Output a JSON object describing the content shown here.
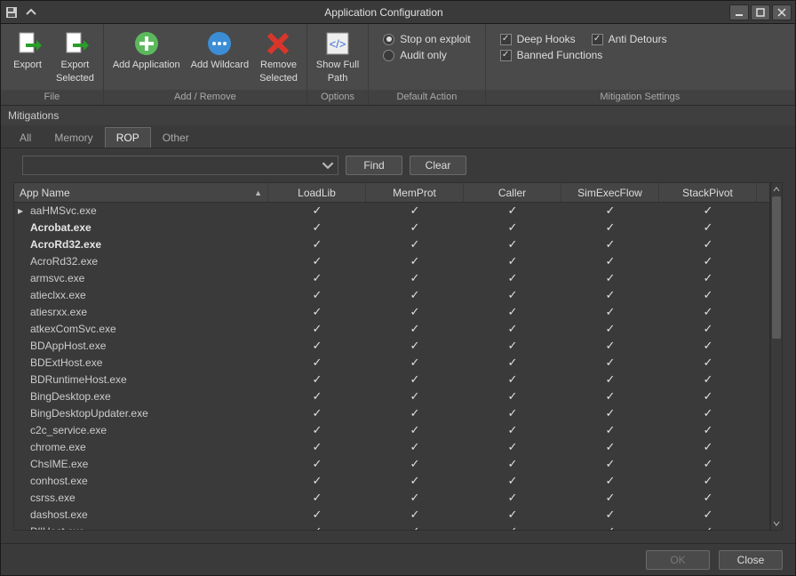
{
  "window": {
    "title": "Application Configuration"
  },
  "ribbon": {
    "file": {
      "label": "File",
      "export": "Export",
      "export_selected_l1": "Export",
      "export_selected_l2": "Selected"
    },
    "addremove": {
      "label": "Add / Remove",
      "add_app": "Add Application",
      "add_wild": "Add Wildcard",
      "remove_l1": "Remove",
      "remove_l2": "Selected"
    },
    "options": {
      "label": "Options",
      "show_l1": "Show Full",
      "show_l2": "Path"
    },
    "default_action": {
      "label": "Default Action",
      "stop": "Stop on exploit",
      "audit": "Audit only"
    },
    "mitigation": {
      "label": "Mitigation Settings",
      "deep": "Deep Hooks",
      "anti": "Anti Detours",
      "banned": "Banned Functions"
    }
  },
  "section": {
    "title": "Mitigations"
  },
  "tabs": [
    "All",
    "Memory",
    "ROP",
    "Other"
  ],
  "active_tab_index": 2,
  "search": {
    "find": "Find",
    "clear": "Clear"
  },
  "columns": [
    "App Name",
    "LoadLib",
    "MemProt",
    "Caller",
    "SimExecFlow",
    "StackPivot"
  ],
  "rows": [
    {
      "name": "aaHMSvc.exe",
      "bold": false,
      "current": true,
      "v": [
        true,
        true,
        true,
        true,
        true
      ]
    },
    {
      "name": "Acrobat.exe",
      "bold": true,
      "v": [
        true,
        true,
        true,
        true,
        true
      ]
    },
    {
      "name": "AcroRd32.exe",
      "bold": true,
      "v": [
        true,
        true,
        true,
        true,
        true
      ]
    },
    {
      "name": "AcroRd32.exe",
      "bold": false,
      "v": [
        true,
        true,
        true,
        true,
        true
      ]
    },
    {
      "name": "armsvc.exe",
      "bold": false,
      "v": [
        true,
        true,
        true,
        true,
        true
      ]
    },
    {
      "name": "atieclxx.exe",
      "bold": false,
      "v": [
        true,
        true,
        true,
        true,
        true
      ]
    },
    {
      "name": "atiesrxx.exe",
      "bold": false,
      "v": [
        true,
        true,
        true,
        true,
        true
      ]
    },
    {
      "name": "atkexComSvc.exe",
      "bold": false,
      "v": [
        true,
        true,
        true,
        true,
        true
      ]
    },
    {
      "name": "BDAppHost.exe",
      "bold": false,
      "v": [
        true,
        true,
        true,
        true,
        true
      ]
    },
    {
      "name": "BDExtHost.exe",
      "bold": false,
      "v": [
        true,
        true,
        true,
        true,
        true
      ]
    },
    {
      "name": "BDRuntimeHost.exe",
      "bold": false,
      "v": [
        true,
        true,
        true,
        true,
        true
      ]
    },
    {
      "name": "BingDesktop.exe",
      "bold": false,
      "v": [
        true,
        true,
        true,
        true,
        true
      ]
    },
    {
      "name": "BingDesktopUpdater.exe",
      "bold": false,
      "v": [
        true,
        true,
        true,
        true,
        true
      ]
    },
    {
      "name": "c2c_service.exe",
      "bold": false,
      "v": [
        true,
        true,
        true,
        true,
        true
      ]
    },
    {
      "name": "chrome.exe",
      "bold": false,
      "v": [
        true,
        true,
        true,
        true,
        true
      ]
    },
    {
      "name": "ChsIME.exe",
      "bold": false,
      "v": [
        true,
        true,
        true,
        true,
        true
      ]
    },
    {
      "name": "conhost.exe",
      "bold": false,
      "v": [
        true,
        true,
        true,
        true,
        true
      ]
    },
    {
      "name": "csrss.exe",
      "bold": false,
      "v": [
        true,
        true,
        true,
        true,
        true
      ]
    },
    {
      "name": "dashost.exe",
      "bold": false,
      "v": [
        true,
        true,
        true,
        true,
        true
      ]
    },
    {
      "name": "DllHost.exe",
      "bold": false,
      "v": [
        true,
        true,
        true,
        true,
        true
      ]
    }
  ],
  "footer": {
    "ok": "OK",
    "close": "Close"
  }
}
